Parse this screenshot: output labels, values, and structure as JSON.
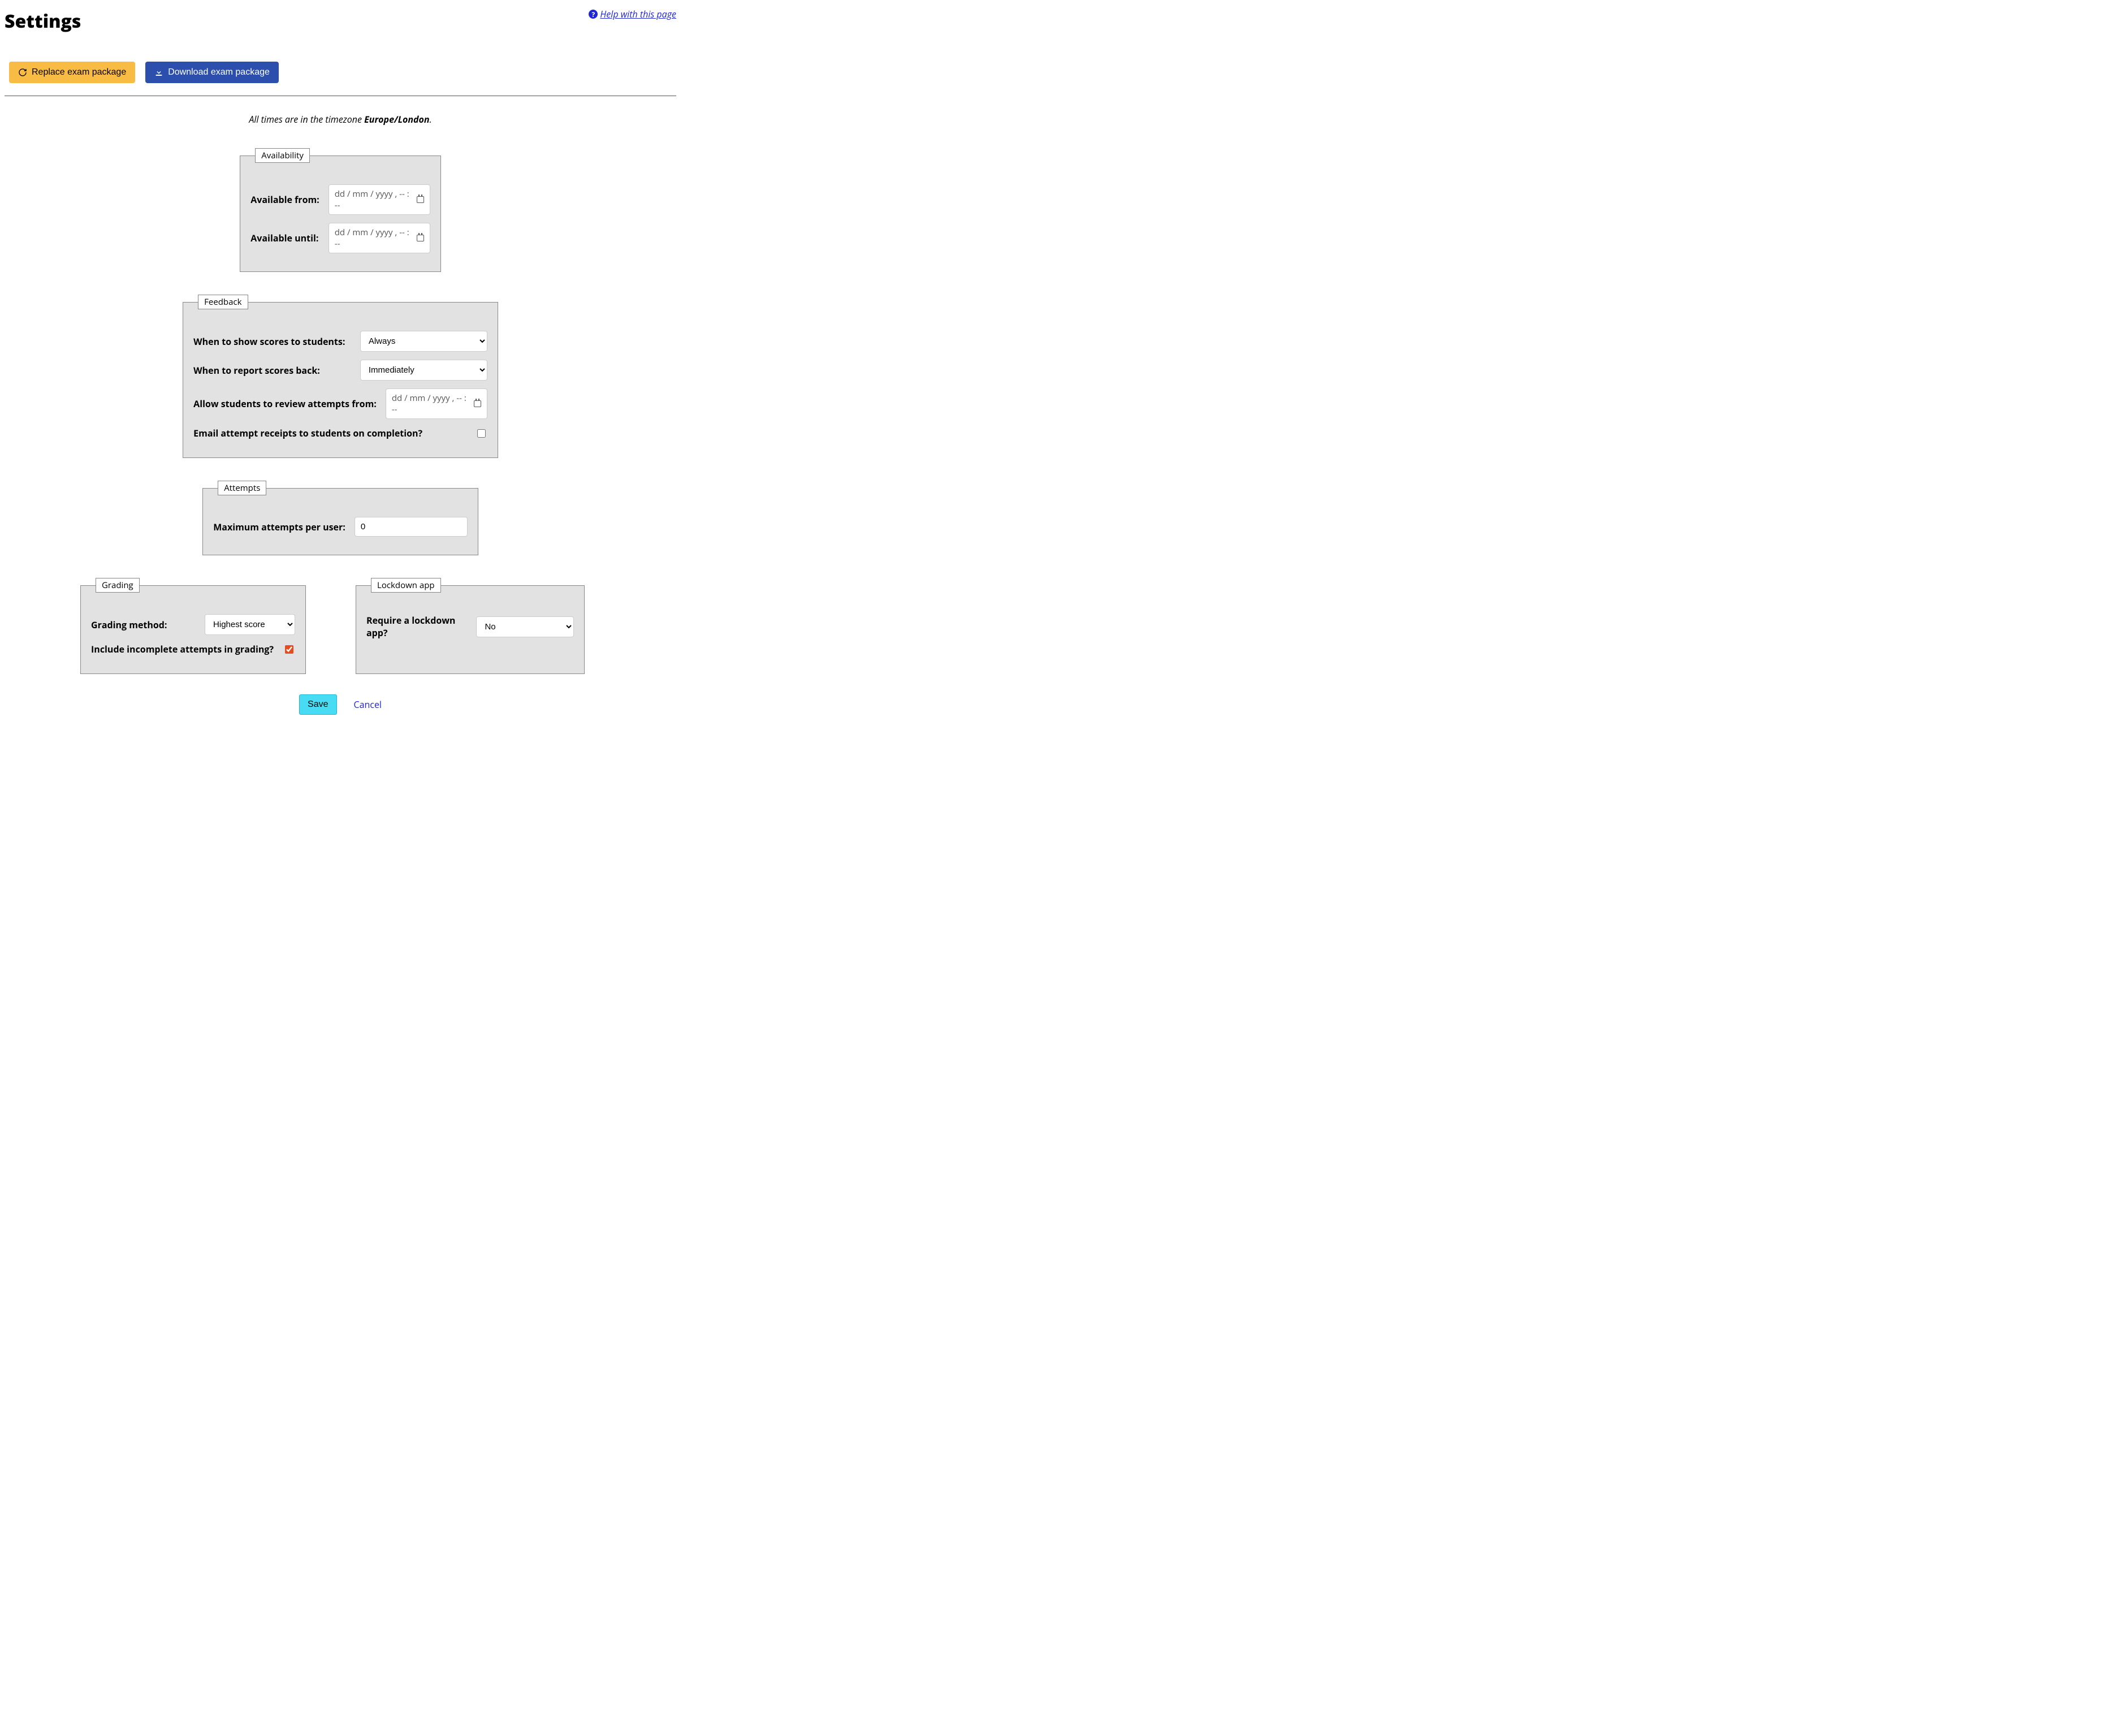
{
  "header": {
    "title": "Settings",
    "help_label": " Help with this page"
  },
  "buttons": {
    "replace": "Replace exam package",
    "download": "Download exam package"
  },
  "timezone_notice": {
    "prefix": "All times are in the timezone ",
    "tz": "Europe/London",
    "suffix": "."
  },
  "availability": {
    "legend": "Availability",
    "from_label": "Available from:",
    "until_label": "Available until:",
    "placeholder": "dd / mm / yyyy ,  -- : --"
  },
  "feedback": {
    "legend": "Feedback",
    "show_scores_label": "When to show scores to students:",
    "show_scores_value": "Always",
    "report_back_label": "When to report scores back:",
    "report_back_value": "Immediately",
    "review_from_label": "Allow students to review attempts from:",
    "review_placeholder": "dd / mm / yyyy ,  -- : --",
    "email_receipt_label": "Email attempt receipts to students on completion?",
    "email_receipt_checked": false
  },
  "attempts": {
    "legend": "Attempts",
    "max_label": "Maximum attempts per user:",
    "max_value": "0"
  },
  "grading": {
    "legend": "Grading",
    "method_label": "Grading method:",
    "method_value": "Highest score",
    "include_incomplete_label": "Include incomplete attempts in grading?",
    "include_incomplete_checked": true
  },
  "lockdown": {
    "legend": "Lockdown app",
    "label": "Require a lockdown app?",
    "value": "No"
  },
  "actions": {
    "save": "Save",
    "cancel": "Cancel"
  }
}
